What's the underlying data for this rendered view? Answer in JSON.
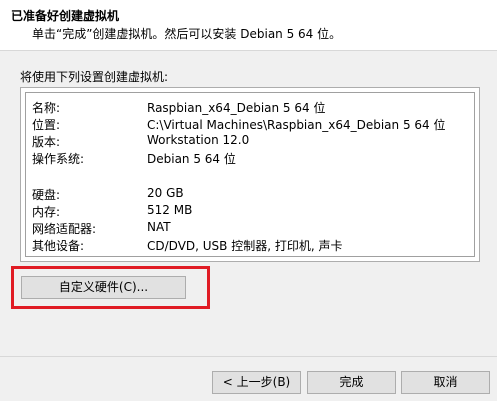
{
  "header": {
    "title": "已准备好创建虚拟机",
    "subtitle": "单击“完成”创建虚拟机。然后可以安装 Debian 5 64 位。"
  },
  "intro": "将使用下列设置创建虚拟机:",
  "summary": {
    "rows": [
      {
        "label": "名称:",
        "value": "Raspbian_x64_Debian 5 64 位"
      },
      {
        "label": "位置:",
        "value": "C:\\Virtual Machines\\Raspbian_x64_Debian 5 64 位"
      },
      {
        "label": "版本:",
        "value": "Workstation 12.0"
      },
      {
        "label": "操作系统:",
        "value": "Debian 5 64 位"
      },
      {
        "label": "硬盘:",
        "value": "20 GB"
      },
      {
        "label": "内存:",
        "value": "512 MB"
      },
      {
        "label": "网络适配器:",
        "value": "NAT"
      },
      {
        "label": "其他设备:",
        "value": "CD/DVD, USB 控制器, 打印机, 声卡"
      }
    ]
  },
  "buttons": {
    "customize": "自定义硬件(C)...",
    "back": "< 上一步(B)",
    "finish": "完成",
    "cancel": "取消"
  },
  "colors": {
    "highlight": "#e01b24"
  }
}
